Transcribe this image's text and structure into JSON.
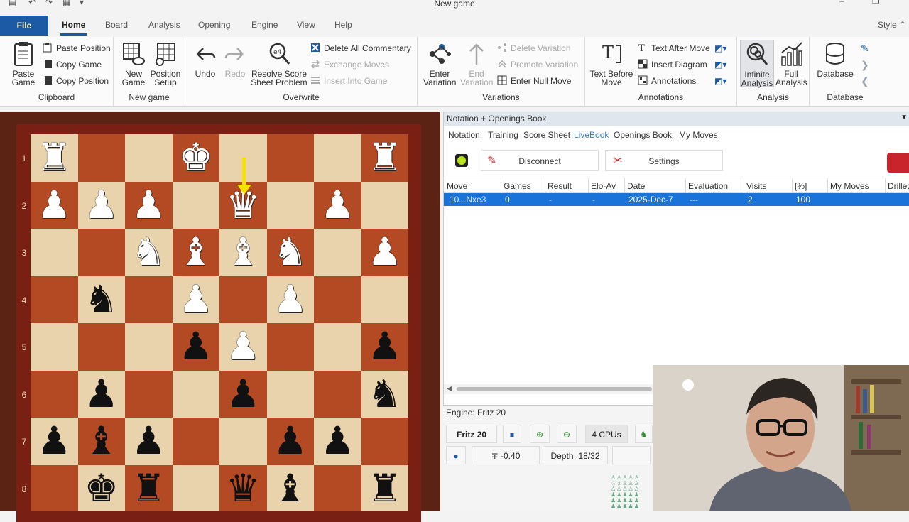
{
  "window": {
    "title": "New game",
    "style_label": "Style"
  },
  "menu": {
    "file": "File",
    "tabs": [
      "Home",
      "Board",
      "Analysis",
      "Opening",
      "Engine",
      "View",
      "Help"
    ]
  },
  "ribbon": {
    "clipboard": {
      "label": "Clipboard",
      "paste_game": "Paste\nGame",
      "paste_position": "Paste Position",
      "copy_game": "Copy Game",
      "copy_position": "Copy Position"
    },
    "new_game": {
      "label": "New game",
      "new_game": "New\nGame",
      "position_setup": "Position\nSetup"
    },
    "overwrite": {
      "label": "Overwrite",
      "undo": "Undo",
      "redo": "Redo",
      "resolve": "Resolve Score\nSheet Problem",
      "delete_all_commentary": "Delete All Commentary",
      "exchange_moves": "Exchange Moves",
      "insert_into_game": "Insert Into Game"
    },
    "variations": {
      "label": "Variations",
      "enter_variation": "Enter\nVariation",
      "end_variation": "End\nVariation",
      "delete_variation": "Delete Variation",
      "promote_variation": "Promote Variation",
      "enter_null_move": "Enter Null Move"
    },
    "annotations": {
      "label": "Annotations",
      "text_before_move": "Text Before\nMove",
      "text_after_move": "Text After Move",
      "insert_diagram": "Insert Diagram",
      "annotations": "Annotations"
    },
    "analysis": {
      "label": "Analysis",
      "infinite_analysis": "Infinite\nAnalysis",
      "full_analysis": "Full\nAnalysis"
    },
    "database": {
      "label": "Database",
      "database": "Database"
    }
  },
  "board": {
    "rank_labels": [
      "1",
      "2",
      "3",
      "4",
      "5",
      "6",
      "7",
      "8"
    ],
    "pieces": [
      {
        "sq": "a1",
        "p": "♜",
        "c": "white"
      },
      {
        "sq": "d1",
        "p": "♚",
        "c": "white"
      },
      {
        "sq": "h1",
        "p": "♜",
        "c": "white"
      },
      {
        "sq": "a2",
        "p": "♟",
        "c": "white"
      },
      {
        "sq": "b2",
        "p": "♟",
        "c": "white"
      },
      {
        "sq": "c2",
        "p": "♟",
        "c": "white"
      },
      {
        "sq": "e2",
        "p": "♛",
        "c": "white"
      },
      {
        "sq": "g2",
        "p": "♟",
        "c": "white"
      },
      {
        "sq": "c3",
        "p": "♞",
        "c": "white"
      },
      {
        "sq": "d3",
        "p": "♝",
        "c": "white"
      },
      {
        "sq": "e3",
        "p": "♝",
        "c": "white"
      },
      {
        "sq": "f3",
        "p": "♞",
        "c": "white"
      },
      {
        "sq": "h3",
        "p": "♟",
        "c": "white"
      },
      {
        "sq": "b4",
        "p": "♞",
        "c": "black"
      },
      {
        "sq": "d4",
        "p": "♟",
        "c": "white"
      },
      {
        "sq": "f4",
        "p": "♟",
        "c": "white"
      },
      {
        "sq": "d5",
        "p": "♟",
        "c": "black"
      },
      {
        "sq": "e5",
        "p": "♟",
        "c": "white"
      },
      {
        "sq": "h5",
        "p": "♟",
        "c": "black"
      },
      {
        "sq": "b6",
        "p": "♟",
        "c": "black"
      },
      {
        "sq": "e6",
        "p": "♟",
        "c": "black"
      },
      {
        "sq": "h6",
        "p": "♞",
        "c": "black"
      },
      {
        "sq": "a7",
        "p": "♟",
        "c": "black"
      },
      {
        "sq": "b7",
        "p": "♝",
        "c": "black"
      },
      {
        "sq": "c7",
        "p": "♟",
        "c": "black"
      },
      {
        "sq": "f7",
        "p": "♟",
        "c": "black"
      },
      {
        "sq": "g7",
        "p": "♟",
        "c": "black"
      },
      {
        "sq": "b8",
        "p": "♚",
        "c": "black"
      },
      {
        "sq": "c8",
        "p": "♜",
        "c": "black"
      },
      {
        "sq": "e8",
        "p": "♛",
        "c": "black"
      },
      {
        "sq": "f8",
        "p": "♝",
        "c": "black"
      },
      {
        "sq": "h8",
        "p": "♜",
        "c": "black"
      }
    ],
    "arrow_color": "#f5e300"
  },
  "notation": {
    "panel_title": "Notation + Openings Book",
    "subtabs": [
      "Notation",
      "Training",
      "Score Sheet",
      "LiveBook",
      "Openings Book",
      "My Moves"
    ],
    "active_subtab": "LiveBook",
    "disconnect_label": "Disconnect",
    "settings_label": "Settings",
    "columns": [
      "Move",
      "Games",
      "Result",
      "Elo-Av",
      "Date",
      "Evaluation",
      "Visits",
      "[%]",
      "My Moves",
      "Drilled"
    ],
    "rows": [
      [
        "10...Nxe3",
        "0",
        "-",
        "-",
        "2025-Dec-7",
        "---",
        "2",
        "100",
        "",
        ""
      ]
    ]
  },
  "engine": {
    "title": "Engine: Fritz 20",
    "name": "Fritz 20",
    "cpus": "4 CPUs",
    "eval": "∓ -0.40",
    "depth": "Depth=18/32"
  },
  "colors": {
    "accent": "#1c5aa6",
    "selection": "#1a73d9",
    "board_light": "#e8d3ad",
    "board_dark": "#b34a23"
  }
}
